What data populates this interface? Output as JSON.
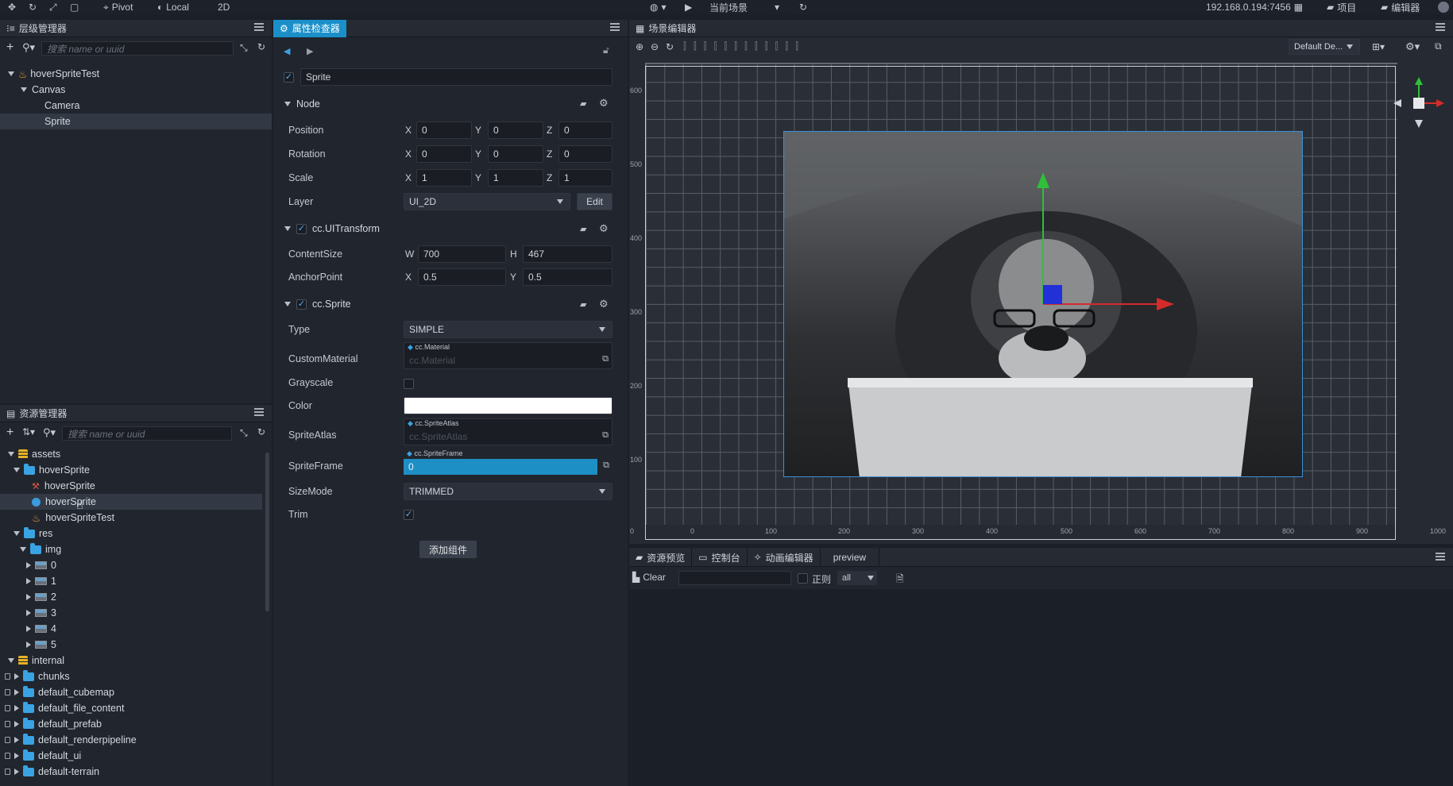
{
  "toolbar": {
    "pivot": "Pivot",
    "local": "Local",
    "mode2d": "2D",
    "scene_select": "当前场景",
    "ip": "192.168.0.194:7456",
    "project": "项目",
    "editor": "编辑器"
  },
  "hierarchy": {
    "title": "层级管理器",
    "search_placeholder": "搜索 name or uuid",
    "nodes": [
      "hoverSpriteTest",
      "Canvas",
      "Camera",
      "Sprite"
    ]
  },
  "assets": {
    "title": "资源管理器",
    "search_placeholder": "搜索 name or uuid",
    "items": [
      "assets",
      "hoverSprite",
      "hoverSprite",
      "hoverSprite",
      "hoverSpriteTest",
      "res",
      "img",
      "0",
      "1",
      "2",
      "3",
      "4",
      "5",
      "internal",
      "chunks",
      "default_cubemap",
      "default_file_content",
      "default_prefab",
      "default_renderpipeline",
      "default_ui",
      "default-terrain"
    ]
  },
  "inspector": {
    "title": "属性检查器",
    "node_name": "Sprite",
    "node_section": "Node",
    "position_label": "Position",
    "rotation_label": "Rotation",
    "scale_label": "Scale",
    "layer_label": "Layer",
    "pos": {
      "x": "0",
      "y": "0",
      "z": "0"
    },
    "rot": {
      "x": "0",
      "y": "0",
      "z": "0"
    },
    "scale": {
      "x": "1",
      "y": "1",
      "z": "1"
    },
    "layer": "UI_2D",
    "edit": "Edit",
    "uitransform_section": "cc.UITransform",
    "content_size_label": "ContentSize",
    "anchor_label": "AnchorPoint",
    "size": {
      "w": "700",
      "h": "467"
    },
    "anchor": {
      "x": "0.5",
      "y": "0.5"
    },
    "sprite_section": "cc.Sprite",
    "type_label": "Type",
    "type": "SIMPLE",
    "material_label": "CustomMaterial",
    "material_tag": "cc.Material",
    "material_ph": "cc.Material",
    "grayscale_label": "Grayscale",
    "color_label": "Color",
    "atlas_label": "SpriteAtlas",
    "atlas_tag": "cc.SpriteAtlas",
    "atlas_ph": "cc.SpriteAtlas",
    "frame_label": "SpriteFrame",
    "frame_tag": "cc.SpriteFrame",
    "frame_value": "0",
    "sizemode_label": "SizeMode",
    "sizemode": "TRIMMED",
    "trim_label": "Trim",
    "add_component": "添加组件",
    "axis": {
      "x": "X",
      "y": "Y",
      "z": "Z",
      "w": "W",
      "h": "H"
    },
    "colors": {
      "active_tab": "#1a8fc9",
      "check": "#4db3f0",
      "frame_field": "#1e8fc4"
    }
  },
  "scene": {
    "title": "场景编辑器",
    "camera_select": "Default De...",
    "x_ticks": [
      "0",
      "100",
      "200",
      "300",
      "400",
      "500",
      "600",
      "700",
      "800",
      "900",
      "1000"
    ],
    "y_ticks": [
      "600",
      "500",
      "400",
      "300",
      "200",
      "100",
      "0"
    ]
  },
  "console": {
    "tabs": [
      "资源预览",
      "控制台",
      "动画编辑器",
      "preview"
    ],
    "clear": "Clear",
    "regex": "正则",
    "level": "all"
  }
}
